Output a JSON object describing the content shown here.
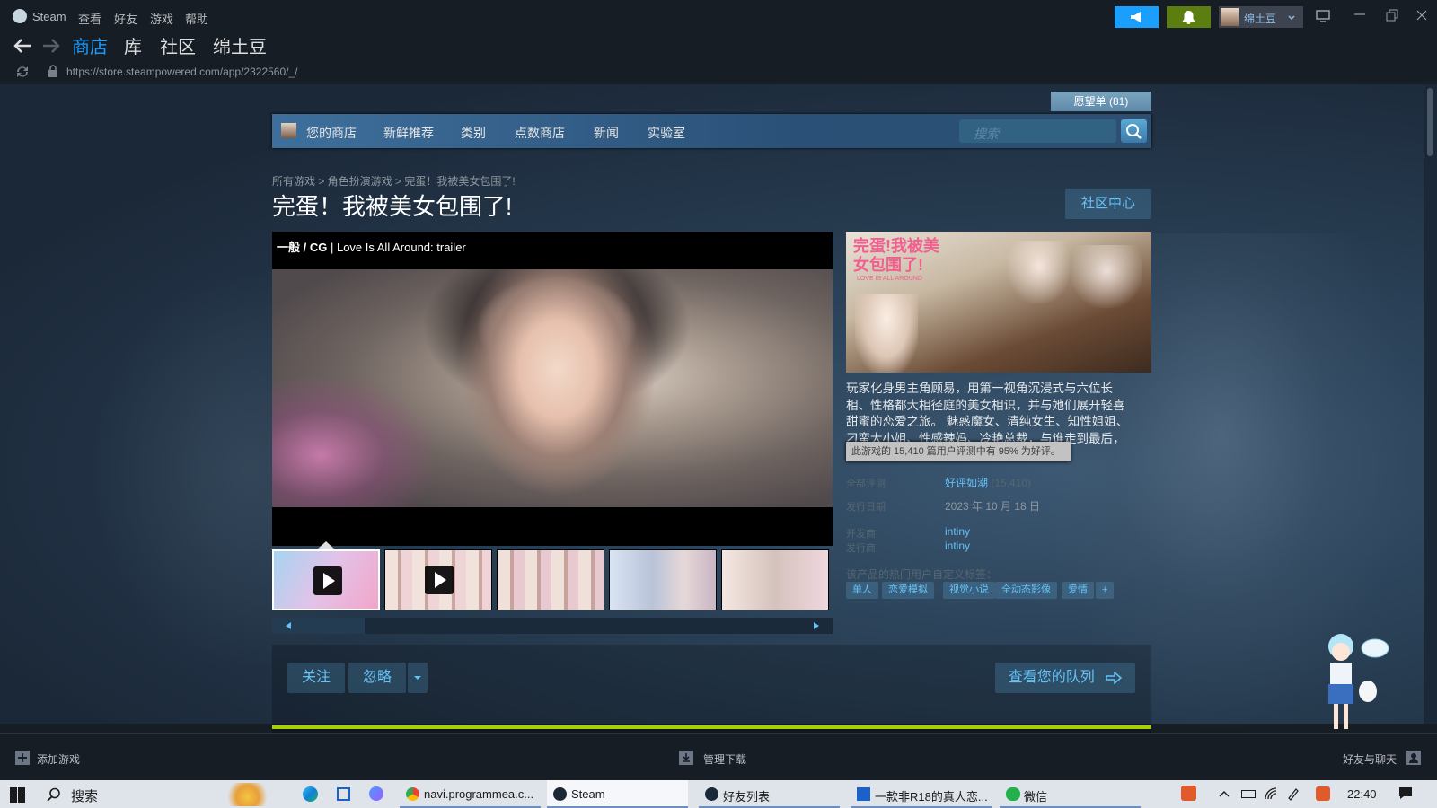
{
  "menubar": {
    "app": "Steam",
    "items": [
      "查看",
      "好友",
      "游戏",
      "帮助"
    ],
    "username": "绵土豆"
  },
  "nav": {
    "tabs": [
      "商店",
      "库",
      "社区",
      "绵土豆"
    ],
    "url": "https://store.steampowered.com/app/2322560/_/"
  },
  "store": {
    "wishlist": "愿望单 (81)",
    "nav_items": [
      "您的商店",
      "新鲜推荐",
      "类别",
      "点数商店",
      "新闻",
      "实验室"
    ],
    "search_placeholder": "搜索",
    "breadcrumb": "所有游戏 > 角色扮演游戏 > 完蛋！我被美女包围了!",
    "title": "完蛋！我被美女包围了!",
    "community_hub": "社区中心",
    "video_label_tag": "一般 / CG",
    "video_label_title": "| Love Is All Around: trailer",
    "description": "玩家化身男主角顾易，用第一视角沉浸式与六位长相、性格都大相径庭的美女相识，并与她们展开轻喜甜蜜的恋爱之旅。 魅惑魔女、清纯女生、知性姐姐、刁蛮大小姐、性感辣妈、冷艳总裁，与谁走到最后，",
    "tooltip": "此游戏的 15,410 篇用户评测中有 95% 为好评。",
    "capsule_title": "完蛋!我被美女包围了!",
    "capsule_subtitle": "LOVE IS ALL AROUND",
    "info": {
      "reviews_label": "全部评测",
      "reviews_value": "好评如潮",
      "reviews_count": "(15,410)",
      "release_label": "发行日期",
      "release_value": "2023 年 10 月 18 日",
      "developer_label": "开发商",
      "developer_value": "intiny",
      "publisher_label": "发行商",
      "publisher_value": "intiny"
    },
    "tags_label": "该产品的热门用户自定义标签：",
    "tags": [
      "单人",
      "恋爱模拟",
      "视觉小说",
      "全动态影像",
      "爱情",
      "+"
    ],
    "follow": "关注",
    "ignore": "忽略",
    "queue": "查看您的队列"
  },
  "bottom": {
    "add_game": "添加游戏",
    "manage_downloads": "管理下载",
    "friends_chat": "好友与聊天"
  },
  "taskbar": {
    "search": "搜索",
    "items": [
      "navi.programmea.c...",
      "Steam",
      "好友列表",
      "一款非R18的真人恋...",
      "微信"
    ],
    "time": "22:40"
  },
  "colors": {
    "accent": "#67c1f5",
    "title_bg": "#171d25",
    "green_top_button": "#5c7e10",
    "blue_top_button": "#1a9fff"
  }
}
